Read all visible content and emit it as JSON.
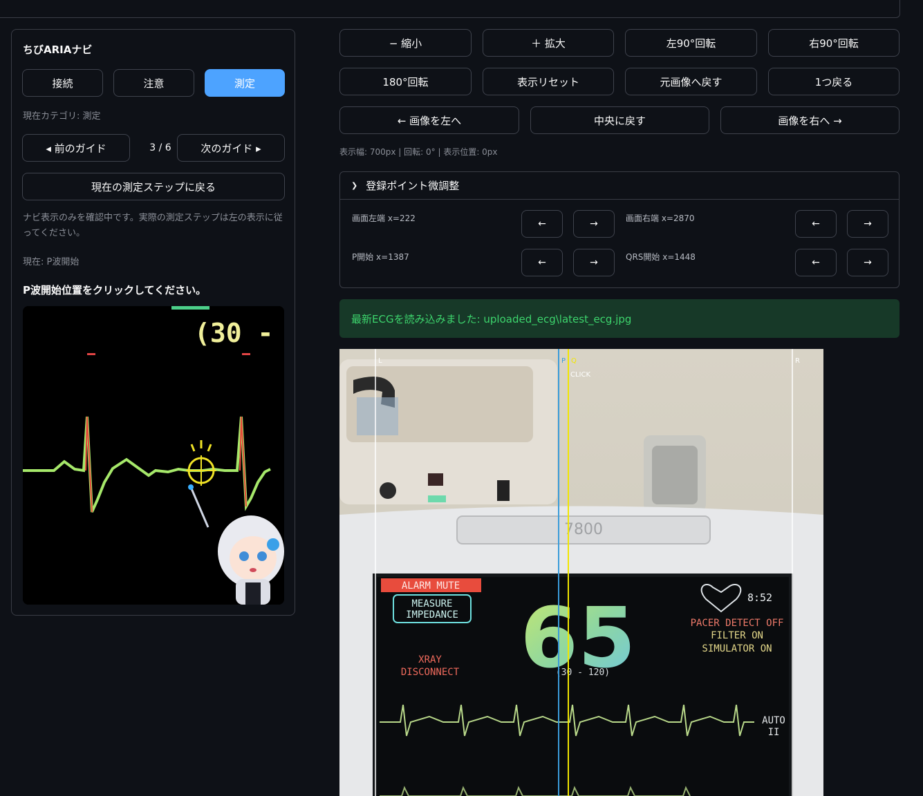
{
  "left_panel": {
    "title": "ちびARIAナビ",
    "categories": [
      "接続",
      "注意",
      "測定"
    ],
    "current_category": "現在カテゴリ: 測定",
    "prev_guide": "◂ 前のガイド",
    "guide_count": "3 / 6",
    "next_guide": "次のガイド ▸",
    "return_step": "現在の測定ステップに戻る",
    "nav_note": "ナビ表示のみを確認中です。実際の測定ステップは左の表示に従ってください。",
    "current_step": "現在: P波開始",
    "instruction": "P波開始位置をクリックしてください。",
    "guide_image": {
      "range_text": "(30 -"
    }
  },
  "toolbar": {
    "row1": [
      "− 縮小",
      "＋ 拡大",
      "左90°回転",
      "右90°回転"
    ],
    "row2": [
      "180°回転",
      "表示リセット",
      "元画像へ戻す",
      "1つ戻る"
    ],
    "row3": [
      "← 画像を左へ",
      "中央に戻す",
      "画像を右へ →"
    ]
  },
  "info_line": "表示幅: 700px | 回転: 0° | 表示位置: 0px",
  "fine_tune": {
    "title": "登録ポイント微調整",
    "items": [
      {
        "label": "画面左端 x=222"
      },
      {
        "label": "画面右端 x=2870"
      },
      {
        "label": "P開始 x=1387"
      },
      {
        "label": "QRS開始 x=1448"
      }
    ],
    "left_arrow": "←",
    "right_arrow": "→"
  },
  "status_message": "最新ECGを読み込みました: uploaded_ecg\\latest_ecg.jpg",
  "ecg_photo": {
    "markers": {
      "left": "L",
      "p": "P",
      "q": "Q",
      "right": "R",
      "click": "CLICK"
    },
    "device_model": "7800",
    "alarm_mute": "ALARM MUTE",
    "measure_line1": "MEASURE",
    "measure_line2": "IMPEDANCE",
    "heart_rate": "65",
    "time": "8:52",
    "pacer": "PACER DETECT OFF",
    "filter": "FILTER ON",
    "simulator": "SIMULATOR ON",
    "xray_line1": "XRAY",
    "xray_line2": "DISCONNECT",
    "range": "(30 - 120)",
    "lead_auto": "AUTO",
    "lead_ii": "II"
  },
  "colors": {
    "accent": "#4da3ff",
    "success_bg": "#173928",
    "success_text": "#3dd56d",
    "marker_blue": "#3a9bd9",
    "marker_yellow": "#f2e600"
  }
}
